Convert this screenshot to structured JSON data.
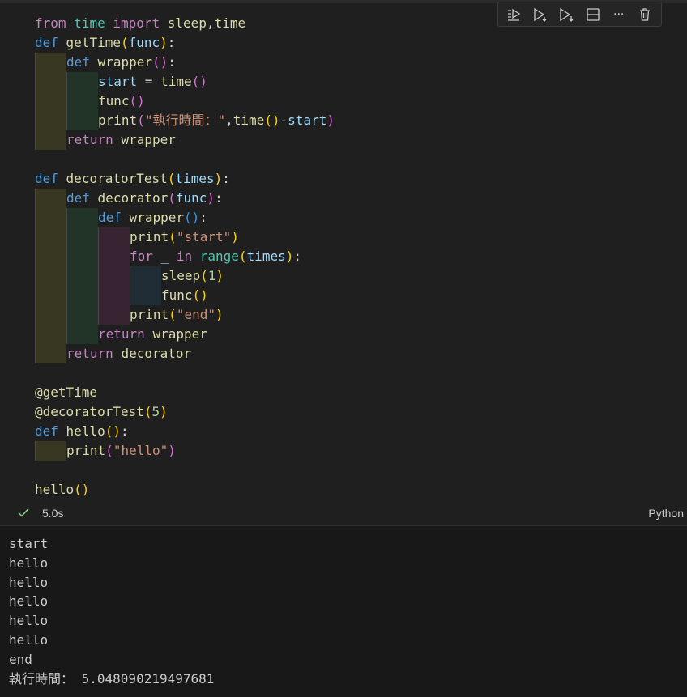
{
  "toolbar": {
    "buttons": [
      {
        "name": "execute-above-cells",
        "icon": "run-above-icon"
      },
      {
        "name": "execute-cell-and-below",
        "icon": "run-below-icon"
      },
      {
        "name": "execute-and-move",
        "icon": "run-next-icon"
      },
      {
        "name": "split-cell",
        "icon": "split-icon"
      },
      {
        "name": "more-actions",
        "icon": "ellipsis-icon",
        "glyph": "···"
      },
      {
        "name": "delete-cell",
        "icon": "trash-icon"
      }
    ]
  },
  "code_lines": [
    {
      "indent": 0,
      "tokens": [
        {
          "t": "from",
          "c": "ctl"
        },
        {
          "t": " "
        },
        {
          "t": "time",
          "c": "mod"
        },
        {
          "t": " "
        },
        {
          "t": "import",
          "c": "ctl"
        },
        {
          "t": " "
        },
        {
          "t": "sleep",
          "c": "fn"
        },
        {
          "t": ","
        },
        {
          "t": "time",
          "c": "fn"
        }
      ]
    },
    {
      "indent": 0,
      "tokens": [
        {
          "t": "def",
          "c": "kw"
        },
        {
          "t": " "
        },
        {
          "t": "getTime",
          "c": "fn"
        },
        {
          "t": "(",
          "c": "p1"
        },
        {
          "t": "func",
          "c": "var"
        },
        {
          "t": ")",
          "c": "p1"
        },
        {
          "t": ":"
        }
      ]
    },
    {
      "indent": 1,
      "tokens": [
        {
          "t": "def",
          "c": "kw"
        },
        {
          "t": " "
        },
        {
          "t": "wrapper",
          "c": "fn"
        },
        {
          "t": "()",
          "c": "p2"
        },
        {
          "t": ":"
        }
      ]
    },
    {
      "indent": 2,
      "tokens": [
        {
          "t": "start",
          "c": "var"
        },
        {
          "t": " = "
        },
        {
          "t": "time",
          "c": "fn"
        },
        {
          "t": "()",
          "c": "p2"
        }
      ]
    },
    {
      "indent": 2,
      "tokens": [
        {
          "t": "func",
          "c": "fn"
        },
        {
          "t": "()",
          "c": "p2"
        }
      ]
    },
    {
      "indent": 2,
      "tokens": [
        {
          "t": "print",
          "c": "fn"
        },
        {
          "t": "(",
          "c": "p2"
        },
        {
          "t": "\"執行時間：\"",
          "c": "str"
        },
        {
          "t": ","
        },
        {
          "t": "time",
          "c": "fn"
        },
        {
          "t": "()",
          "c": "p1"
        },
        {
          "t": "-"
        },
        {
          "t": "start",
          "c": "var"
        },
        {
          "t": ")",
          "c": "p2"
        }
      ]
    },
    {
      "indent": 1,
      "tokens": [
        {
          "t": "return",
          "c": "ctl"
        },
        {
          "t": " "
        },
        {
          "t": "wrapper",
          "c": "fn"
        }
      ]
    },
    {
      "indent": 0,
      "tokens": []
    },
    {
      "indent": 0,
      "tokens": [
        {
          "t": "def",
          "c": "kw"
        },
        {
          "t": " "
        },
        {
          "t": "decoratorTest",
          "c": "fn"
        },
        {
          "t": "(",
          "c": "p1"
        },
        {
          "t": "times",
          "c": "var"
        },
        {
          "t": ")",
          "c": "p1"
        },
        {
          "t": ":"
        }
      ]
    },
    {
      "indent": 1,
      "tokens": [
        {
          "t": "def",
          "c": "kw"
        },
        {
          "t": " "
        },
        {
          "t": "decorator",
          "c": "fn"
        },
        {
          "t": "(",
          "c": "p2"
        },
        {
          "t": "func",
          "c": "var"
        },
        {
          "t": ")",
          "c": "p2"
        },
        {
          "t": ":"
        }
      ]
    },
    {
      "indent": 2,
      "tokens": [
        {
          "t": "def",
          "c": "kw"
        },
        {
          "t": " "
        },
        {
          "t": "wrapper",
          "c": "fn"
        },
        {
          "t": "()",
          "c": "p3"
        },
        {
          "t": ":"
        }
      ]
    },
    {
      "indent": 3,
      "tokens": [
        {
          "t": "print",
          "c": "fn"
        },
        {
          "t": "(",
          "c": "p1"
        },
        {
          "t": "\"start\"",
          "c": "str"
        },
        {
          "t": ")",
          "c": "p1"
        }
      ]
    },
    {
      "indent": 3,
      "tokens": [
        {
          "t": "for",
          "c": "ctl"
        },
        {
          "t": " "
        },
        {
          "t": "_",
          "c": "var"
        },
        {
          "t": " "
        },
        {
          "t": "in",
          "c": "ctl"
        },
        {
          "t": " "
        },
        {
          "t": "range",
          "c": "mod"
        },
        {
          "t": "(",
          "c": "p1"
        },
        {
          "t": "times",
          "c": "var"
        },
        {
          "t": ")",
          "c": "p1"
        },
        {
          "t": ":"
        }
      ]
    },
    {
      "indent": 4,
      "tokens": [
        {
          "t": "sleep",
          "c": "fn"
        },
        {
          "t": "(",
          "c": "p1"
        },
        {
          "t": "1",
          "c": "num"
        },
        {
          "t": ")",
          "c": "p1"
        }
      ]
    },
    {
      "indent": 4,
      "tokens": [
        {
          "t": "func",
          "c": "fn"
        },
        {
          "t": "()",
          "c": "p1"
        }
      ]
    },
    {
      "indent": 3,
      "tokens": [
        {
          "t": "print",
          "c": "fn"
        },
        {
          "t": "(",
          "c": "p1"
        },
        {
          "t": "\"end\"",
          "c": "str"
        },
        {
          "t": ")",
          "c": "p1"
        }
      ]
    },
    {
      "indent": 2,
      "tokens": [
        {
          "t": "return",
          "c": "ctl"
        },
        {
          "t": " "
        },
        {
          "t": "wrapper",
          "c": "fn"
        }
      ]
    },
    {
      "indent": 1,
      "tokens": [
        {
          "t": "return",
          "c": "ctl"
        },
        {
          "t": " "
        },
        {
          "t": "decorator",
          "c": "fn"
        }
      ]
    },
    {
      "indent": 0,
      "tokens": []
    },
    {
      "indent": 0,
      "tokens": [
        {
          "t": "@getTime",
          "c": "dec"
        }
      ]
    },
    {
      "indent": 0,
      "tokens": [
        {
          "t": "@decoratorTest",
          "c": "dec"
        },
        {
          "t": "(",
          "c": "p1"
        },
        {
          "t": "5",
          "c": "num"
        },
        {
          "t": ")",
          "c": "p1"
        }
      ]
    },
    {
      "indent": 0,
      "tokens": [
        {
          "t": "def",
          "c": "kw"
        },
        {
          "t": " "
        },
        {
          "t": "hello",
          "c": "fn"
        },
        {
          "t": "()",
          "c": "p1"
        },
        {
          "t": ":"
        }
      ]
    },
    {
      "indent": 1,
      "tokens": [
        {
          "t": "print",
          "c": "fn"
        },
        {
          "t": "(",
          "c": "p2"
        },
        {
          "t": "\"hello\"",
          "c": "str"
        },
        {
          "t": ")",
          "c": "p2"
        }
      ]
    },
    {
      "indent": 0,
      "tokens": []
    },
    {
      "indent": 0,
      "tokens": [
        {
          "t": "hello",
          "c": "fn"
        },
        {
          "t": "()",
          "c": "p1"
        }
      ]
    }
  ],
  "status": {
    "execution_time": "5.0s",
    "language": "Python",
    "success_color": "#89d185"
  },
  "output_lines": [
    "start",
    "hello",
    "hello",
    "hello",
    "hello",
    "hello",
    "end",
    "執行時間： 5.048090219497681"
  ]
}
